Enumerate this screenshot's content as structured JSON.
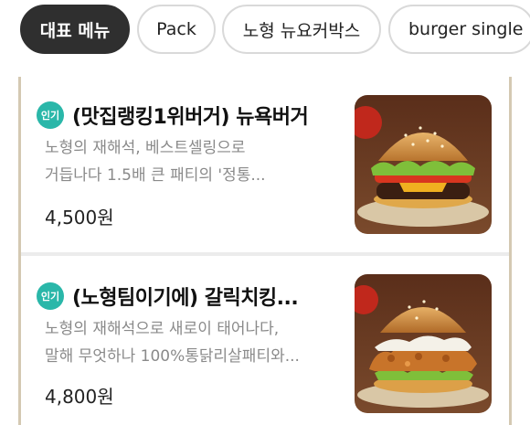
{
  "category_tabs": [
    {
      "label": "대표 메뉴",
      "active": true
    },
    {
      "label": "Pack",
      "active": false
    },
    {
      "label": "노형 뉴요커박스",
      "active": false
    },
    {
      "label": "burger single",
      "active": false
    }
  ],
  "menu_items": [
    {
      "badge": "인기",
      "title": "(맛집랭킹1위버거) 뉴욕버거",
      "desc_line1": "노형의 재해석, 베스트셀링으로",
      "desc_line2": "거듭나다      1.5배 큰 패티의 '정통...",
      "price": "4,500원",
      "image_icon": "burger-photo"
    },
    {
      "badge": "인기",
      "title": "(노형팀이기에) 갈릭치킹...",
      "desc_line1": "노형의 재해석으로 새로이 태어나다,",
      "desc_line2": "말해 무엇하나 100%통닭리살패티와...",
      "price": "4,800원",
      "image_icon": "chicken-burger-photo"
    }
  ],
  "colors": {
    "active_tab_bg": "#2f2f2f",
    "badge_bg": "#2ab7a9",
    "panel_border": "#d4c9b2"
  }
}
